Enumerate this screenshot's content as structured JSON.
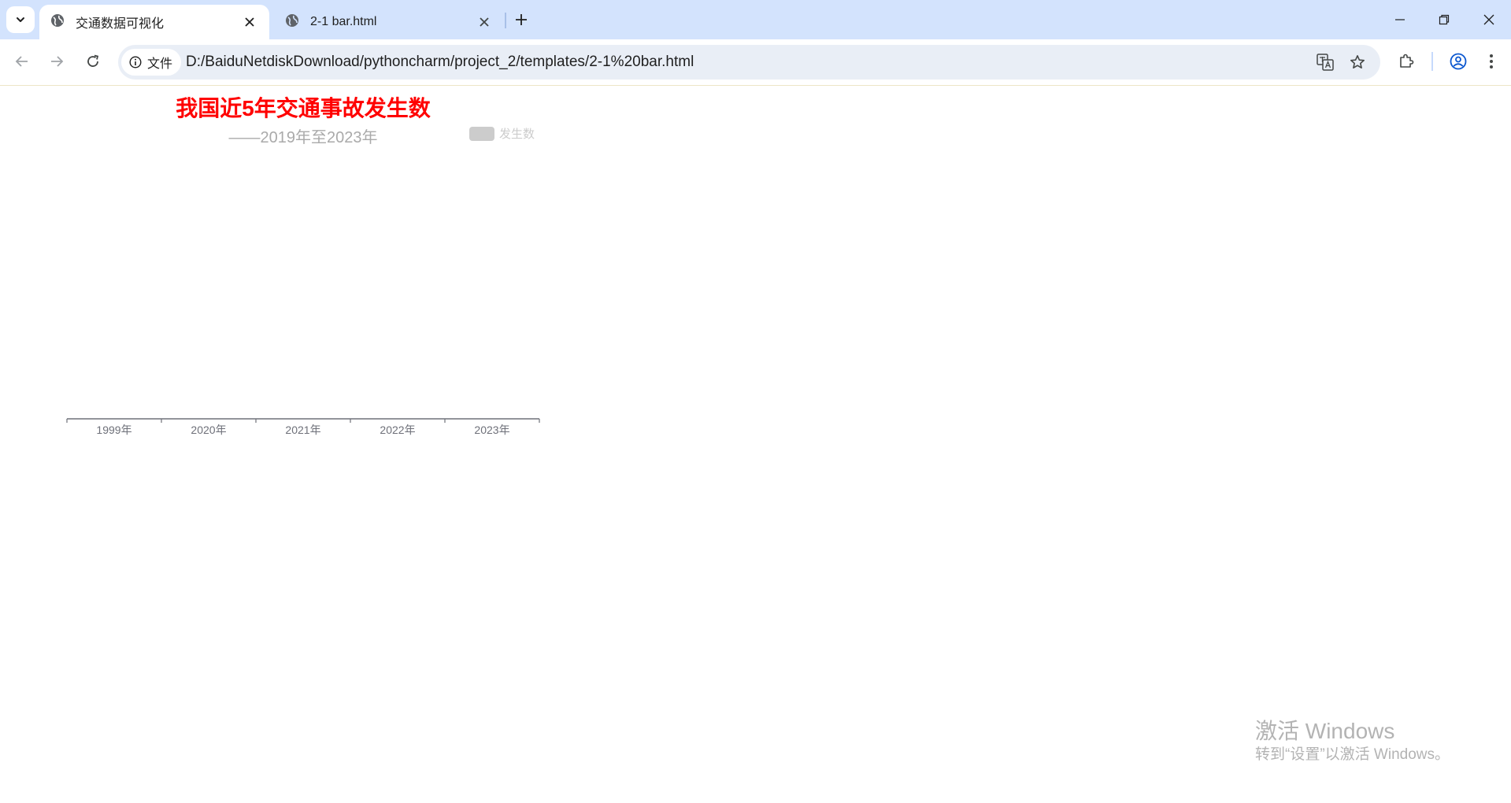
{
  "browser": {
    "tabs": [
      {
        "title": "交通数据可视化",
        "active": true
      },
      {
        "title": "2-1 bar.html",
        "active": false
      }
    ],
    "address_bar": {
      "site_chip_label": "文件",
      "url": "D:/BaiduNetdiskDownload/pythoncharm/project_2/templates/2-1%20bar.html"
    },
    "tab_strip_color": "#d3e3fd"
  },
  "page": {
    "title": "我国近5年交通事故发生数",
    "subtitle": "——2019年至2023年",
    "title_color": "#ff0000",
    "legend_label": "发生数"
  },
  "chart_data": {
    "type": "bar",
    "title": "我国近5年交通事故发生数",
    "subtitle": "——2019年至2023年",
    "categories": [
      "1999年",
      "2020年",
      "2021年",
      "2022年",
      "2023年"
    ],
    "series": [
      {
        "name": "发生数",
        "values": [
          null,
          null,
          null,
          null,
          null
        ],
        "color": "#cccccc",
        "legend_hidden": true
      }
    ],
    "legend_position": "top-right",
    "grid": false
  },
  "watermark": {
    "title": "激活 Windows",
    "subtitle": "转到“设置”以激活 Windows。"
  }
}
